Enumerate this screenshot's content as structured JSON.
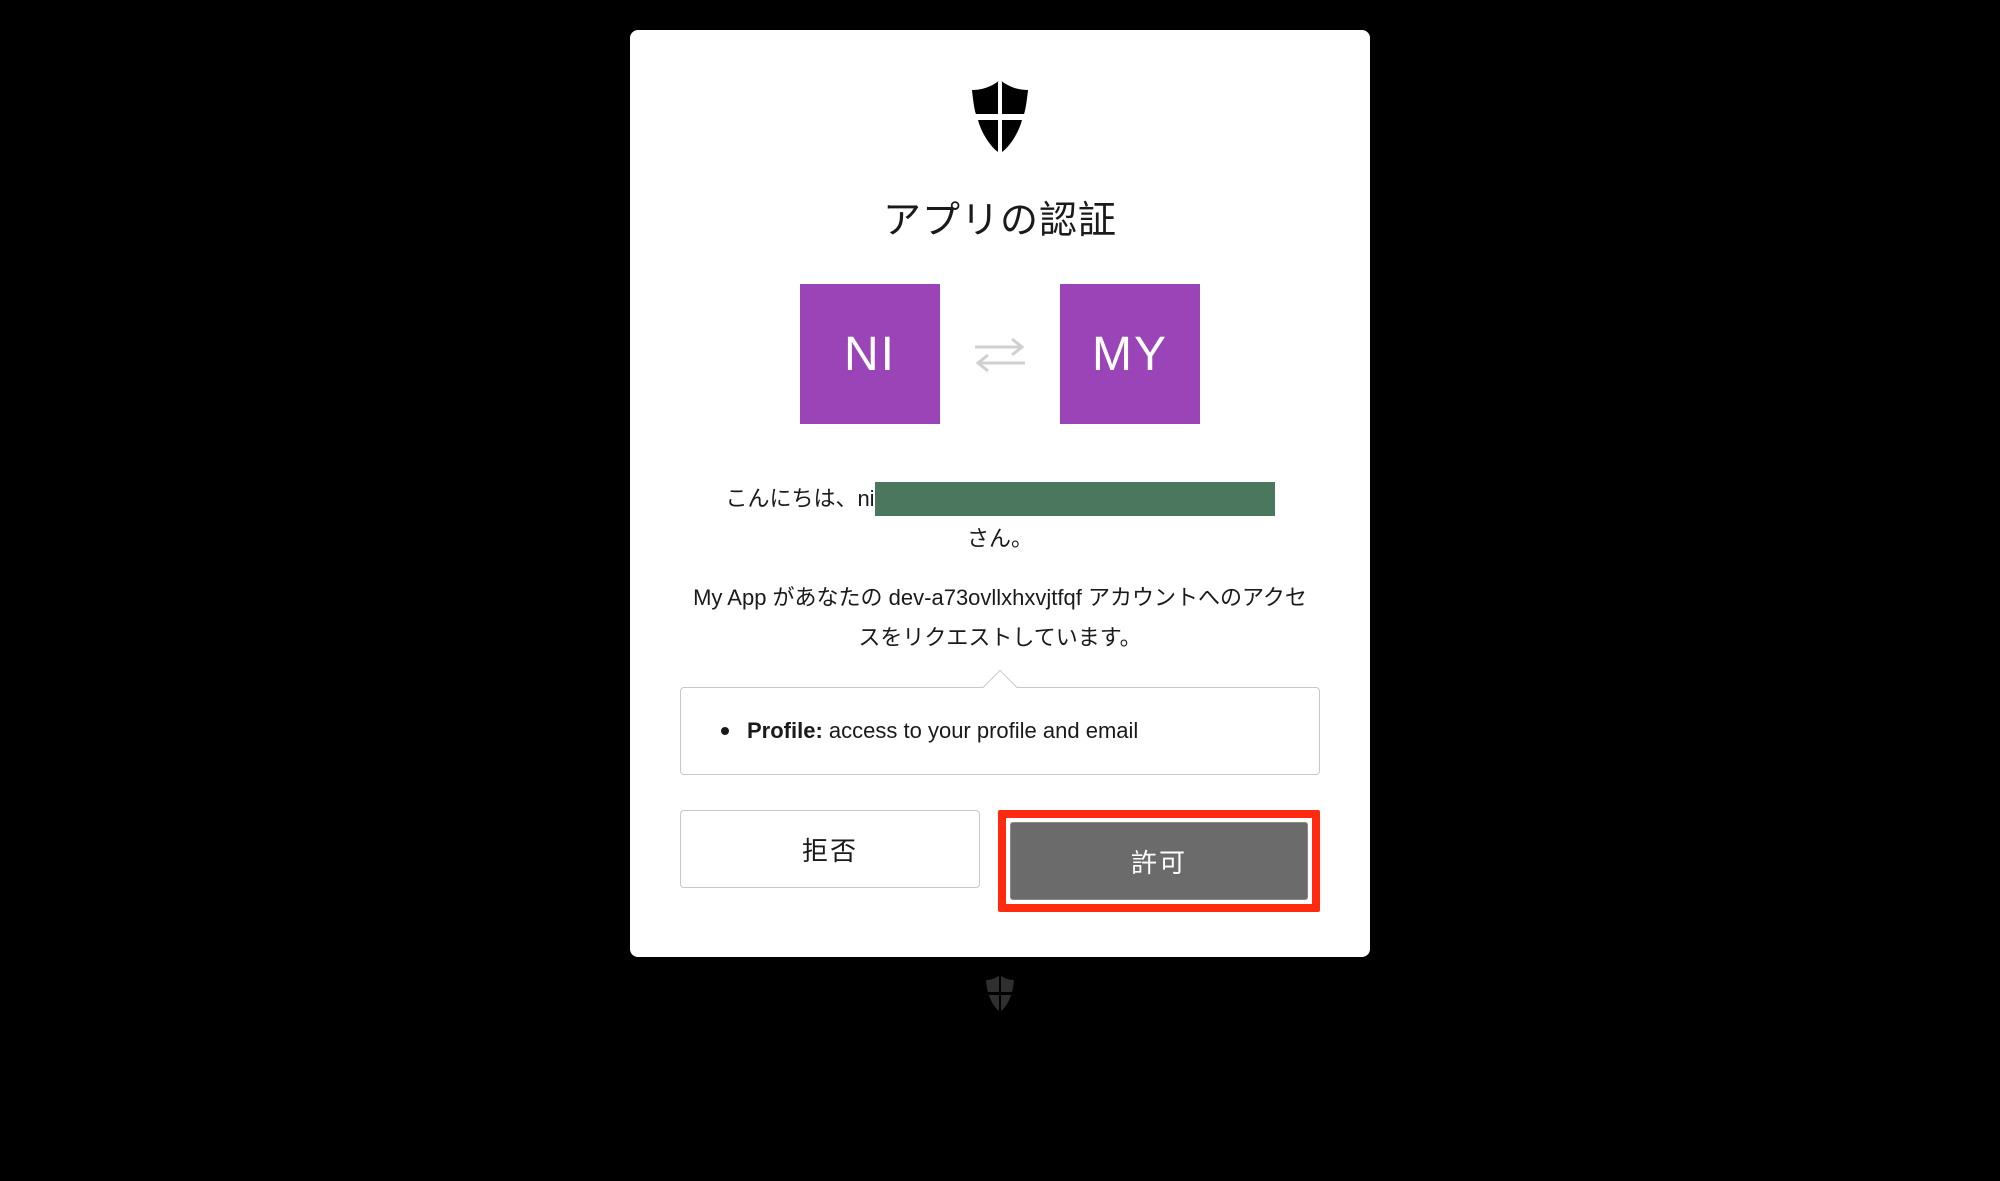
{
  "title": "アプリの認証",
  "tiles": {
    "left": "NI",
    "right": "MY"
  },
  "greeting": {
    "prefix": "こんにちは、ni",
    "suffix": "さん。"
  },
  "request": "My App があなたの dev-a73ovllxhxvjtfqf アカウントへのアクセスをリクエストしています。",
  "scope": {
    "label": "Profile:",
    "description": "access to your profile and email"
  },
  "buttons": {
    "deny": "拒否",
    "allow": "許可"
  },
  "colors": {
    "tile": "#9b44b8",
    "highlight": "#ff2a0f",
    "allow_bg": "#6b6b6b"
  }
}
